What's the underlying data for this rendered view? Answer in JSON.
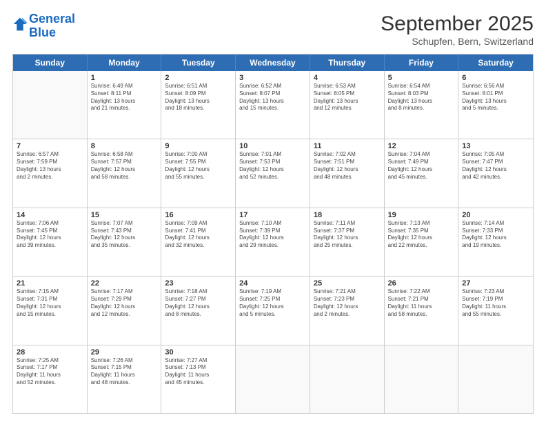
{
  "logo": {
    "line1": "General",
    "line2": "Blue"
  },
  "header": {
    "month": "September 2025",
    "location": "Schupfen, Bern, Switzerland"
  },
  "days": [
    "Sunday",
    "Monday",
    "Tuesday",
    "Wednesday",
    "Thursday",
    "Friday",
    "Saturday"
  ],
  "rows": [
    [
      {
        "day": "",
        "info": ""
      },
      {
        "day": "1",
        "info": "Sunrise: 6:49 AM\nSunset: 8:11 PM\nDaylight: 13 hours\nand 21 minutes."
      },
      {
        "day": "2",
        "info": "Sunrise: 6:51 AM\nSunset: 8:09 PM\nDaylight: 13 hours\nand 18 minutes."
      },
      {
        "day": "3",
        "info": "Sunrise: 6:52 AM\nSunset: 8:07 PM\nDaylight: 13 hours\nand 15 minutes."
      },
      {
        "day": "4",
        "info": "Sunrise: 6:53 AM\nSunset: 8:05 PM\nDaylight: 13 hours\nand 12 minutes."
      },
      {
        "day": "5",
        "info": "Sunrise: 6:54 AM\nSunset: 8:03 PM\nDaylight: 13 hours\nand 8 minutes."
      },
      {
        "day": "6",
        "info": "Sunrise: 6:56 AM\nSunset: 8:01 PM\nDaylight: 13 hours\nand 5 minutes."
      }
    ],
    [
      {
        "day": "7",
        "info": "Sunrise: 6:57 AM\nSunset: 7:59 PM\nDaylight: 13 hours\nand 2 minutes."
      },
      {
        "day": "8",
        "info": "Sunrise: 6:58 AM\nSunset: 7:57 PM\nDaylight: 12 hours\nand 58 minutes."
      },
      {
        "day": "9",
        "info": "Sunrise: 7:00 AM\nSunset: 7:55 PM\nDaylight: 12 hours\nand 55 minutes."
      },
      {
        "day": "10",
        "info": "Sunrise: 7:01 AM\nSunset: 7:53 PM\nDaylight: 12 hours\nand 52 minutes."
      },
      {
        "day": "11",
        "info": "Sunrise: 7:02 AM\nSunset: 7:51 PM\nDaylight: 12 hours\nand 48 minutes."
      },
      {
        "day": "12",
        "info": "Sunrise: 7:04 AM\nSunset: 7:49 PM\nDaylight: 12 hours\nand 45 minutes."
      },
      {
        "day": "13",
        "info": "Sunrise: 7:05 AM\nSunset: 7:47 PM\nDaylight: 12 hours\nand 42 minutes."
      }
    ],
    [
      {
        "day": "14",
        "info": "Sunrise: 7:06 AM\nSunset: 7:45 PM\nDaylight: 12 hours\nand 39 minutes."
      },
      {
        "day": "15",
        "info": "Sunrise: 7:07 AM\nSunset: 7:43 PM\nDaylight: 12 hours\nand 35 minutes."
      },
      {
        "day": "16",
        "info": "Sunrise: 7:09 AM\nSunset: 7:41 PM\nDaylight: 12 hours\nand 32 minutes."
      },
      {
        "day": "17",
        "info": "Sunrise: 7:10 AM\nSunset: 7:39 PM\nDaylight: 12 hours\nand 29 minutes."
      },
      {
        "day": "18",
        "info": "Sunrise: 7:11 AM\nSunset: 7:37 PM\nDaylight: 12 hours\nand 25 minutes."
      },
      {
        "day": "19",
        "info": "Sunrise: 7:13 AM\nSunset: 7:35 PM\nDaylight: 12 hours\nand 22 minutes."
      },
      {
        "day": "20",
        "info": "Sunrise: 7:14 AM\nSunset: 7:33 PM\nDaylight: 12 hours\nand 19 minutes."
      }
    ],
    [
      {
        "day": "21",
        "info": "Sunrise: 7:15 AM\nSunset: 7:31 PM\nDaylight: 12 hours\nand 15 minutes."
      },
      {
        "day": "22",
        "info": "Sunrise: 7:17 AM\nSunset: 7:29 PM\nDaylight: 12 hours\nand 12 minutes."
      },
      {
        "day": "23",
        "info": "Sunrise: 7:18 AM\nSunset: 7:27 PM\nDaylight: 12 hours\nand 8 minutes."
      },
      {
        "day": "24",
        "info": "Sunrise: 7:19 AM\nSunset: 7:25 PM\nDaylight: 12 hours\nand 5 minutes."
      },
      {
        "day": "25",
        "info": "Sunrise: 7:21 AM\nSunset: 7:23 PM\nDaylight: 12 hours\nand 2 minutes."
      },
      {
        "day": "26",
        "info": "Sunrise: 7:22 AM\nSunset: 7:21 PM\nDaylight: 11 hours\nand 58 minutes."
      },
      {
        "day": "27",
        "info": "Sunrise: 7:23 AM\nSunset: 7:19 PM\nDaylight: 11 hours\nand 55 minutes."
      }
    ],
    [
      {
        "day": "28",
        "info": "Sunrise: 7:25 AM\nSunset: 7:17 PM\nDaylight: 11 hours\nand 52 minutes."
      },
      {
        "day": "29",
        "info": "Sunrise: 7:26 AM\nSunset: 7:15 PM\nDaylight: 11 hours\nand 48 minutes."
      },
      {
        "day": "30",
        "info": "Sunrise: 7:27 AM\nSunset: 7:13 PM\nDaylight: 11 hours\nand 45 minutes."
      },
      {
        "day": "",
        "info": ""
      },
      {
        "day": "",
        "info": ""
      },
      {
        "day": "",
        "info": ""
      },
      {
        "day": "",
        "info": ""
      }
    ]
  ]
}
